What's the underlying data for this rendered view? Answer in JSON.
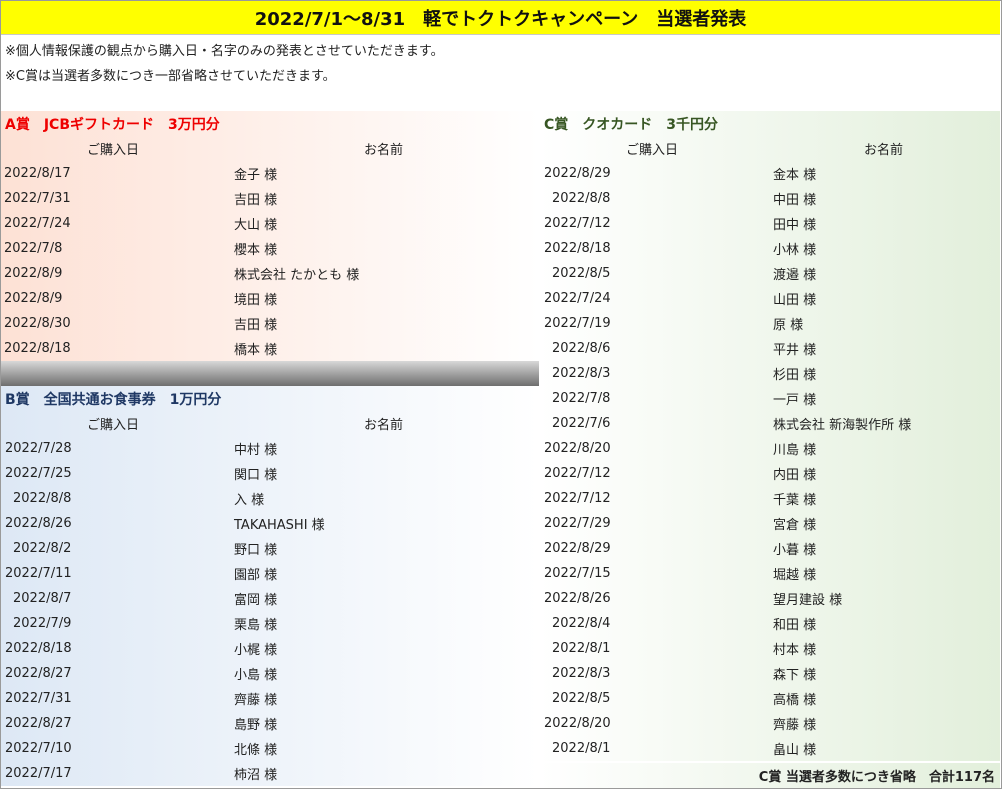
{
  "title": "2022/7/1〜8/31　軽でトクトクキャンペーン　当選者発表",
  "notes": [
    "※個人情報保護の観点から購入日・名字のみの発表とさせていただきます。",
    "※C賞は当選者多数につき一部省略させていただきます。"
  ],
  "columns": {
    "date": "ご購入日",
    "name": "お名前"
  },
  "prize_a": {
    "heading": "A賞　JCBギフトカード　3万円分",
    "rows": [
      {
        "date": "2022/8/17",
        "name": "金子 様"
      },
      {
        "date": "2022/7/31",
        "name": "吉田 様"
      },
      {
        "date": "2022/7/24",
        "name": "大山 様"
      },
      {
        "date": "2022/7/8",
        "name": "櫻本 様"
      },
      {
        "date": "2022/8/9",
        "name": "株式会社 たかとも 様"
      },
      {
        "date": "2022/8/9",
        "name": "境田 様"
      },
      {
        "date": "2022/8/30",
        "name": "吉田 様"
      },
      {
        "date": "2022/8/18",
        "name": "橋本 様"
      }
    ]
  },
  "prize_b": {
    "heading": "B賞　全国共通お食事券　1万円分",
    "rows": [
      {
        "date": "2022/7/28",
        "name": "中村 様"
      },
      {
        "date": "2022/7/25",
        "name": "関口 様"
      },
      {
        "date": "2022/8/8",
        "name": "入 様"
      },
      {
        "date": "2022/8/26",
        "name": "TAKAHASHI 様"
      },
      {
        "date": "2022/8/2",
        "name": "野口 様"
      },
      {
        "date": "2022/7/11",
        "name": "園部 様"
      },
      {
        "date": "2022/8/7",
        "name": "富岡 様"
      },
      {
        "date": "2022/7/9",
        "name": "栗島 様"
      },
      {
        "date": "2022/8/18",
        "name": "小梶 様"
      },
      {
        "date": "2022/8/27",
        "name": "小島 様"
      },
      {
        "date": "2022/7/31",
        "name": "齊藤 様"
      },
      {
        "date": "2022/8/27",
        "name": "島野 様"
      },
      {
        "date": "2022/7/10",
        "name": "北條 様"
      },
      {
        "date": "2022/7/17",
        "name": "柿沼 様"
      }
    ]
  },
  "prize_c": {
    "heading": "C賞　クオカード　3千円分",
    "rows": [
      {
        "date": "2022/8/29",
        "name": "金本 様"
      },
      {
        "date": "2022/8/8",
        "name": "中田 様"
      },
      {
        "date": "2022/7/12",
        "name": "田中 様"
      },
      {
        "date": "2022/8/18",
        "name": "小林 様"
      },
      {
        "date": "2022/8/5",
        "name": "渡邉 様"
      },
      {
        "date": "2022/7/24",
        "name": "山田 様"
      },
      {
        "date": "2022/7/19",
        "name": "原 様"
      },
      {
        "date": "2022/8/6",
        "name": "平井 様"
      },
      {
        "date": "2022/8/3",
        "name": "杉田 様"
      },
      {
        "date": "2022/7/8",
        "name": "一戸 様"
      },
      {
        "date": "2022/7/6",
        "name": "株式会社 新海製作所 様"
      },
      {
        "date": "2022/8/20",
        "name": "川島 様"
      },
      {
        "date": "2022/7/12",
        "name": "内田 様"
      },
      {
        "date": "2022/7/12",
        "name": "千葉 様"
      },
      {
        "date": "2022/7/29",
        "name": "宮倉 様"
      },
      {
        "date": "2022/8/29",
        "name": "小暮 様"
      },
      {
        "date": "2022/7/15",
        "name": "堀越 様"
      },
      {
        "date": "2022/8/26",
        "name": "望月建設 様"
      },
      {
        "date": "2022/8/4",
        "name": "和田 様"
      },
      {
        "date": "2022/8/1",
        "name": "村本 様"
      },
      {
        "date": "2022/8/3",
        "name": "森下 様"
      },
      {
        "date": "2022/8/5",
        "name": "高橋 様"
      },
      {
        "date": "2022/8/20",
        "name": "齊藤 様"
      },
      {
        "date": "2022/8/1",
        "name": "畠山 様"
      }
    ],
    "footer": "C賞 当選者多数につき省略　合計117名"
  }
}
